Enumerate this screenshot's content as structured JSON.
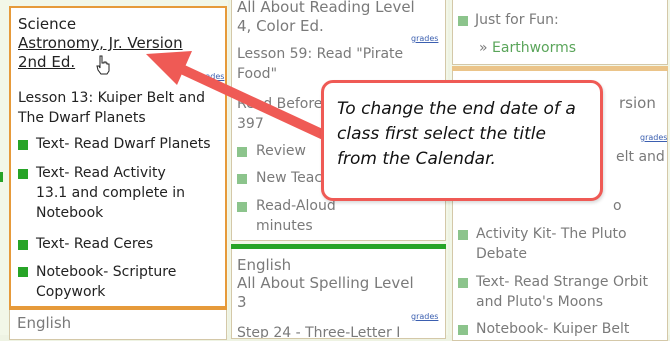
{
  "col1": {
    "card1": {
      "subject": "Science",
      "title_line1": "Astronomy, Jr. Version",
      "title_line2": "2nd Ed.",
      "grades": "grades",
      "lesson": "Lesson 13: Kuiper Belt and The Dwarf Planets",
      "tasks": [
        "Text- Read Dwarf Planets",
        "Text- Read Activity 13.1 and complete in Notebook",
        "Text- Read Ceres",
        "Notebook- Scripture Copywork"
      ]
    },
    "card2": {
      "subject": "English"
    }
  },
  "col2": {
    "card1": {
      "title_line1": "All About Reading Level",
      "title_line2": "4, Color Ed.",
      "grades": "grades",
      "lesson": "Lesson 59: Read \"Pirate Food\"",
      "tasks": [
        "Read Before",
        "397",
        "Review",
        "New Teach",
        "Read-Aloud",
        "minutes"
      ]
    },
    "card2": {
      "subject": "English",
      "title_line1": "All About Spelling Level",
      "title_line2": "3",
      "grades": "grades",
      "lesson": "Step 24 - Three-Letter I"
    }
  },
  "col3": {
    "card1": {
      "task": "Just for Fun:",
      "link": "Earthworms",
      "link_prefix": "»"
    },
    "card2": {
      "title_fragment": "rsion",
      "grades": "grades",
      "fragment1": "elt and",
      "fragment2": "o",
      "tasks": [
        "Activity Kit- The Pluto Debate",
        "Text- Read Strange Orbit and Pluto's Moons",
        "Notebook- Kuiper Belt"
      ]
    }
  },
  "callout": {
    "text": "To change the end date of a class first select the title from the Calendar."
  },
  "colors": {
    "accent_orange": "#e69a3a",
    "done_green": "#27a427",
    "callout_red": "#ef5a55",
    "link_green": "#5aa55a",
    "grades_link": "#3b5fb0"
  }
}
